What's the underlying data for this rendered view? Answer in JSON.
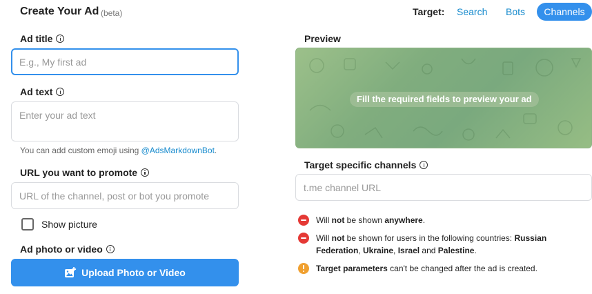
{
  "header": {
    "title": "Create Your Ad",
    "beta": "(beta)",
    "target_label": "Target:",
    "tabs": [
      {
        "label": "Search",
        "active": false
      },
      {
        "label": "Bots",
        "active": false
      },
      {
        "label": "Channels",
        "active": true
      }
    ]
  },
  "form": {
    "ad_title": {
      "label": "Ad title",
      "placeholder": "E.g., My first ad",
      "value": ""
    },
    "ad_text": {
      "label": "Ad text",
      "placeholder": "Enter your ad text",
      "value": "",
      "hint_prefix": "You can add custom emoji using ",
      "hint_link": "@AdsMarkdownBot",
      "hint_suffix": "."
    },
    "url": {
      "label": "URL you want to promote",
      "placeholder": "URL of the channel, post or bot you promote",
      "value": ""
    },
    "show_picture": {
      "label": "Show picture",
      "checked": false
    },
    "ad_photo": {
      "label": "Ad photo or video",
      "button_label": "Upload Photo or Video"
    }
  },
  "preview": {
    "label": "Preview",
    "message": "Fill the required fields to preview your ad"
  },
  "target_channels": {
    "label": "Target specific channels",
    "placeholder": "t.me channel URL",
    "value": ""
  },
  "notices": {
    "anywhere": {
      "pre": "Will ",
      "b1": "not",
      "mid": " be shown ",
      "b2": "anywhere",
      "post": "."
    },
    "countries": {
      "pre": "Will ",
      "b1": "not",
      "mid": " be shown for users in the following countries: ",
      "c1": "Russian Federation",
      "sep1": ", ",
      "c2": "Ukraine",
      "sep2": ", ",
      "c3": "Israel",
      "sep3": " and ",
      "c4": "Palestine",
      "post": "."
    },
    "params": {
      "b1": "Target parameters",
      "post": " can't be changed after the ad is created."
    }
  },
  "colors": {
    "accent": "#3390ec",
    "link": "#168acd",
    "error": "#e53935",
    "warning": "#f0a030",
    "preview_bg": "#86b07f"
  }
}
